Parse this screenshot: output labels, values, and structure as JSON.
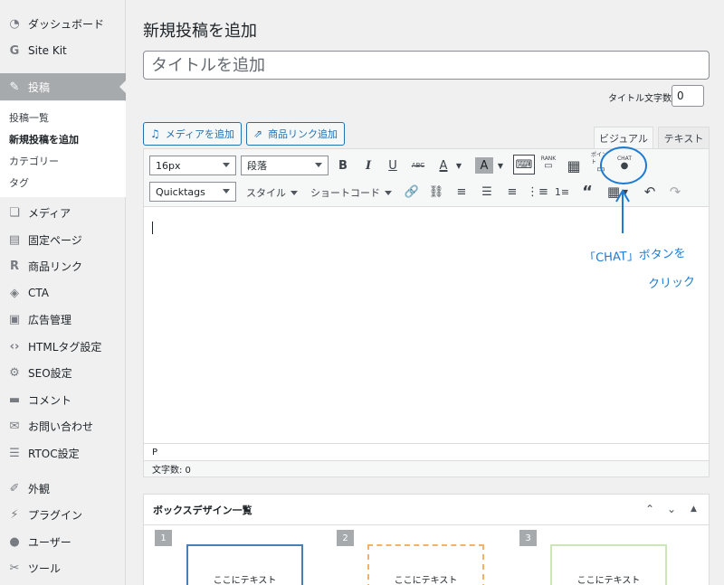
{
  "sidebar": {
    "items": [
      {
        "label": "ダッシュボード",
        "icon": "dashboard-icon",
        "glyph": "◔"
      },
      {
        "label": "Site Kit",
        "icon": "google-g-icon",
        "glyph": "G"
      },
      {
        "label": "投稿",
        "icon": "pin-icon",
        "glyph": "✎"
      },
      {
        "label": "メディア",
        "icon": "media-icon",
        "glyph": "❏"
      },
      {
        "label": "固定ページ",
        "icon": "page-icon",
        "glyph": "▤"
      },
      {
        "label": "商品リンク",
        "icon": "rinker-r-icon",
        "glyph": "R"
      },
      {
        "label": "CTA",
        "icon": "tag-icon",
        "glyph": "◈"
      },
      {
        "label": "広告管理",
        "icon": "ad-icon",
        "glyph": "▣"
      },
      {
        "label": "HTMLタグ設定",
        "icon": "code-icon",
        "glyph": "‹›"
      },
      {
        "label": "SEO設定",
        "icon": "gear-icon",
        "glyph": "⚙"
      },
      {
        "label": "コメント",
        "icon": "comment-icon",
        "glyph": "▬"
      },
      {
        "label": "お問い合わせ",
        "icon": "mail-icon",
        "glyph": "✉"
      },
      {
        "label": "RTOC設定",
        "icon": "list-icon",
        "glyph": "☰"
      },
      {
        "label": "外観",
        "icon": "brush-icon",
        "glyph": "✐"
      },
      {
        "label": "プラグイン",
        "icon": "plugin-icon",
        "glyph": "⚡"
      },
      {
        "label": "ユーザー",
        "icon": "user-icon",
        "glyph": "●"
      },
      {
        "label": "ツール",
        "icon": "wrench-icon",
        "glyph": "✂"
      }
    ],
    "submenu": [
      "投稿一覧",
      "新規投稿を追加",
      "カテゴリー",
      "タグ"
    ]
  },
  "main": {
    "title": "新規投稿を追加",
    "title_placeholder": "タイトルを追加",
    "title_count_label": "タイトル文字数:",
    "title_count": "0",
    "add_media": "メディアを追加",
    "add_product_link": "商品リンク追加",
    "tab_visual": "ビジュアル",
    "tab_text": "テキスト"
  },
  "toolbar": {
    "font_size": "16px",
    "paragraph": "段落",
    "quicktags": "Quicktags",
    "style": "スタイル",
    "shortcode": "ショートコード",
    "rank_label": "RANK",
    "point_label": "ポイント",
    "chat_label": "CHAT"
  },
  "editor": {
    "path": "P",
    "word_count": "文字数: 0"
  },
  "annotation": {
    "line1": "「CHAT」ボタンを",
    "line2": "クリック",
    "color": "#1e7bd1"
  },
  "box_panel": {
    "title": "ボックスデザイン一覧",
    "boxes": [
      {
        "num": "1",
        "text": "ここにテキスト",
        "border": "#4a7fb5",
        "style": "solid"
      },
      {
        "num": "2",
        "text": "ここにテキスト",
        "border": "#f0b26b",
        "style": "dashed"
      },
      {
        "num": "3",
        "text": "ここにテキスト",
        "border": "#cde6b8",
        "style": "solid"
      }
    ]
  }
}
